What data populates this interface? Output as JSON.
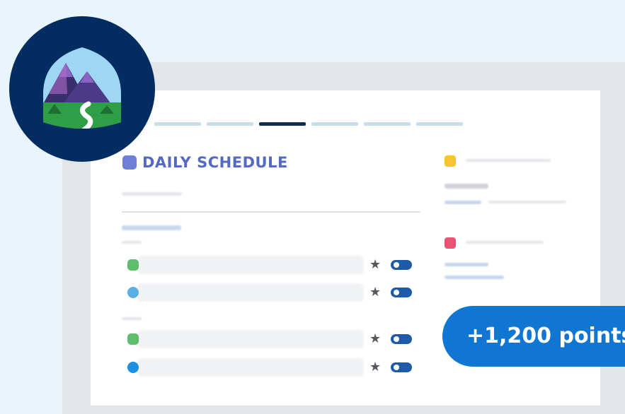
{
  "card": {
    "title": "DAILY SCHEDULE",
    "title_icon": "square-icon"
  },
  "progress": {
    "segments": 6,
    "active_index": 2
  },
  "tasks": [
    {
      "dot_color": "#5dbf6b",
      "starred": true,
      "toggle_on": true
    },
    {
      "dot_color": "#5ab0e6",
      "starred": true,
      "toggle_on": true
    },
    {
      "dot_color": "#5dbf6b",
      "starred": true,
      "toggle_on": true
    },
    {
      "dot_color": "#1b8fe0",
      "starred": true,
      "toggle_on": true
    }
  ],
  "side_cards": [
    {
      "icon_color": "#f5c531"
    },
    {
      "icon_color": "#ea5272"
    }
  ],
  "points_label": "+1,200 points",
  "colors": {
    "badge_background": "#032d60",
    "active_segment": "#0e2b52",
    "title_color": "#5468c4",
    "points_pill": "#1176d1"
  },
  "icons": {
    "star": "star-icon",
    "toggle": "toggle-icon",
    "badge": "mountain-trail-icon"
  }
}
